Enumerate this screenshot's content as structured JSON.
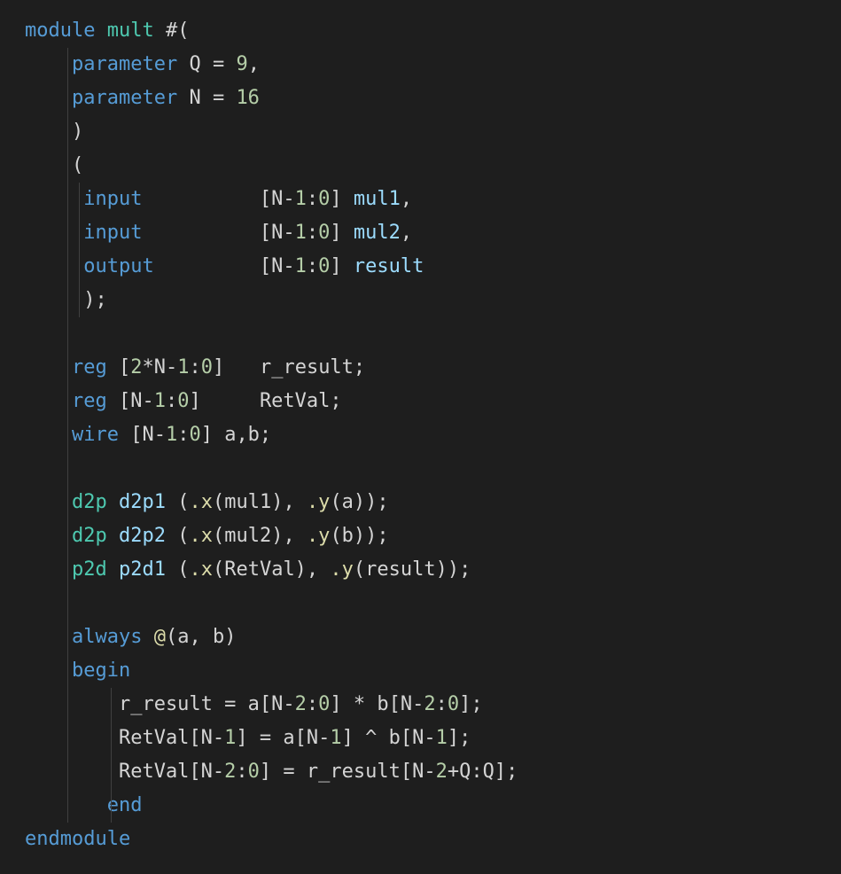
{
  "code": {
    "tokens": [
      [
        [
          "kw",
          "module"
        ],
        [
          "txt",
          " "
        ],
        [
          "type",
          "mult"
        ],
        [
          "txt",
          " #("
        ]
      ],
      [
        [
          "txt",
          "    "
        ],
        [
          "kw",
          "parameter"
        ],
        [
          "txt",
          " Q = "
        ],
        [
          "num",
          "9"
        ],
        [
          "txt",
          ","
        ]
      ],
      [
        [
          "txt",
          "    "
        ],
        [
          "kw",
          "parameter"
        ],
        [
          "txt",
          " N = "
        ],
        [
          "num",
          "16"
        ]
      ],
      [
        [
          "txt",
          "    )"
        ]
      ],
      [
        [
          "txt",
          "    ("
        ]
      ],
      [
        [
          "txt",
          "     "
        ],
        [
          "kw",
          "input"
        ],
        [
          "txt",
          "          [N-"
        ],
        [
          "num",
          "1"
        ],
        [
          "txt",
          ":"
        ],
        [
          "num",
          "0"
        ],
        [
          "txt",
          "] "
        ],
        [
          "var",
          "mul1"
        ],
        [
          "txt",
          ","
        ]
      ],
      [
        [
          "txt",
          "     "
        ],
        [
          "kw",
          "input"
        ],
        [
          "txt",
          "          [N-"
        ],
        [
          "num",
          "1"
        ],
        [
          "txt",
          ":"
        ],
        [
          "num",
          "0"
        ],
        [
          "txt",
          "] "
        ],
        [
          "var",
          "mul2"
        ],
        [
          "txt",
          ","
        ]
      ],
      [
        [
          "txt",
          "     "
        ],
        [
          "kw",
          "output"
        ],
        [
          "txt",
          "         [N-"
        ],
        [
          "num",
          "1"
        ],
        [
          "txt",
          ":"
        ],
        [
          "num",
          "0"
        ],
        [
          "txt",
          "] "
        ],
        [
          "var",
          "result"
        ]
      ],
      [
        [
          "txt",
          "     );"
        ]
      ],
      [
        [
          "txt",
          " "
        ]
      ],
      [
        [
          "txt",
          "    "
        ],
        [
          "kw",
          "reg"
        ],
        [
          "txt",
          " ["
        ],
        [
          "num",
          "2"
        ],
        [
          "txt",
          "*N-"
        ],
        [
          "num",
          "1"
        ],
        [
          "txt",
          ":"
        ],
        [
          "num",
          "0"
        ],
        [
          "txt",
          "]   r_result;"
        ]
      ],
      [
        [
          "txt",
          "    "
        ],
        [
          "kw",
          "reg"
        ],
        [
          "txt",
          " [N-"
        ],
        [
          "num",
          "1"
        ],
        [
          "txt",
          ":"
        ],
        [
          "num",
          "0"
        ],
        [
          "txt",
          "]     RetVal;"
        ]
      ],
      [
        [
          "txt",
          "    "
        ],
        [
          "kw",
          "wire"
        ],
        [
          "txt",
          " [N-"
        ],
        [
          "num",
          "1"
        ],
        [
          "txt",
          ":"
        ],
        [
          "num",
          "0"
        ],
        [
          "txt",
          "] a,b;"
        ]
      ],
      [
        [
          "txt",
          " "
        ]
      ],
      [
        [
          "txt",
          "    "
        ],
        [
          "type",
          "d2p"
        ],
        [
          "txt",
          " "
        ],
        [
          "var",
          "d2p1"
        ],
        [
          "txt",
          " ("
        ],
        [
          "fn",
          ".x"
        ],
        [
          "txt",
          "(mul1), "
        ],
        [
          "fn",
          ".y"
        ],
        [
          "txt",
          "(a));"
        ]
      ],
      [
        [
          "txt",
          "    "
        ],
        [
          "type",
          "d2p"
        ],
        [
          "txt",
          " "
        ],
        [
          "var",
          "d2p2"
        ],
        [
          "txt",
          " ("
        ],
        [
          "fn",
          ".x"
        ],
        [
          "txt",
          "(mul2), "
        ],
        [
          "fn",
          ".y"
        ],
        [
          "txt",
          "(b));"
        ]
      ],
      [
        [
          "txt",
          "    "
        ],
        [
          "type",
          "p2d"
        ],
        [
          "txt",
          " "
        ],
        [
          "var",
          "p2d1"
        ],
        [
          "txt",
          " ("
        ],
        [
          "fn",
          ".x"
        ],
        [
          "txt",
          "(RetVal), "
        ],
        [
          "fn",
          ".y"
        ],
        [
          "txt",
          "(result));"
        ]
      ],
      [
        [
          "txt",
          " "
        ]
      ],
      [
        [
          "txt",
          "    "
        ],
        [
          "kw",
          "always"
        ],
        [
          "txt",
          " "
        ],
        [
          "fn",
          "@"
        ],
        [
          "txt",
          "(a, b)"
        ]
      ],
      [
        [
          "txt",
          "    "
        ],
        [
          "kw",
          "begin"
        ]
      ],
      [
        [
          "txt",
          "        r_result = a[N-"
        ],
        [
          "num",
          "2"
        ],
        [
          "txt",
          ":"
        ],
        [
          "num",
          "0"
        ],
        [
          "txt",
          "] * b[N-"
        ],
        [
          "num",
          "2"
        ],
        [
          "txt",
          ":"
        ],
        [
          "num",
          "0"
        ],
        [
          "txt",
          "];"
        ]
      ],
      [
        [
          "txt",
          "        RetVal[N-"
        ],
        [
          "num",
          "1"
        ],
        [
          "txt",
          "] = a[N-"
        ],
        [
          "num",
          "1"
        ],
        [
          "txt",
          "] ^ b[N-"
        ],
        [
          "num",
          "1"
        ],
        [
          "txt",
          "];"
        ]
      ],
      [
        [
          "txt",
          "        RetVal[N-"
        ],
        [
          "num",
          "2"
        ],
        [
          "txt",
          ":"
        ],
        [
          "num",
          "0"
        ],
        [
          "txt",
          "] = r_result[N-"
        ],
        [
          "num",
          "2"
        ],
        [
          "txt",
          "+Q:Q];"
        ]
      ],
      [
        [
          "txt",
          "       "
        ],
        [
          "kw",
          "end"
        ]
      ],
      [
        [
          "kw",
          "endmodule"
        ]
      ]
    ],
    "guides": [
      {
        "col": 4,
        "from": 1,
        "to": 23
      },
      {
        "col": 5,
        "from": 5,
        "to": 8
      },
      {
        "col": 8,
        "from": 20,
        "to": 23
      }
    ]
  }
}
